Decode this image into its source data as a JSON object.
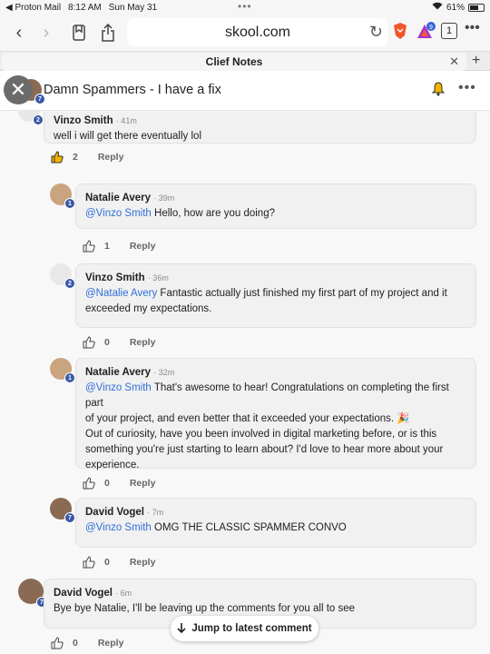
{
  "status": {
    "back_app": "Proton Mail",
    "time": "8:12 AM",
    "date": "Sun May 31",
    "battery": "61%",
    "battery_level": 0.61
  },
  "browser": {
    "url": "skool.com",
    "tab_count": "1",
    "tab_title": "Clief Notes"
  },
  "post": {
    "title": "Damn Spammers - I have a fix",
    "author_level": "7"
  },
  "colors": {
    "mention": "#2e6fd8",
    "level_badge": "#3a58a8",
    "brave_orange": "#f1562b"
  },
  "comments": [
    {
      "name": "Vinzo Smith",
      "time": "· 41m",
      "level": "2",
      "text": "well i will get there eventually lol",
      "likes": "2",
      "reply": "Reply"
    },
    {
      "name": "Natalie Avery",
      "time": "· 39m",
      "level": "1",
      "mention": "@Vinzo Smith",
      "text": " Hello, how are you doing?",
      "likes": "1",
      "reply": "Reply"
    },
    {
      "name": "Vinzo Smith",
      "time": "· 36m",
      "level": "2",
      "mention": "@Natalie Avery",
      "text_l1": " Fantastic actually just finished my first part of my project and it",
      "text_l2": "exceeded my expectations.",
      "likes": "0",
      "reply": "Reply"
    },
    {
      "name": "Natalie Avery",
      "time": "· 32m",
      "level": "1",
      "mention": "@Vinzo Smith",
      "text_l1": " That's awesome to hear! Congratulations on completing the first part",
      "text_l2": "of your project, and even better that it exceeded your expectations. 🎉",
      "text_l3": "Out of curiosity, have you been involved in digital marketing before, or is this",
      "text_l4": "something you're just starting to learn about? I'd love to hear more about your",
      "text_l5": "experience.",
      "likes": "0",
      "reply": "Reply"
    },
    {
      "name": "David Vogel",
      "time": "· 7m",
      "level": "7",
      "mention": "@Vinzo Smith",
      "text": " OMG THE CLASSIC SPAMMER CONVO",
      "likes": "0",
      "reply": "Reply"
    },
    {
      "name": "David Vogel",
      "time": "· 6m",
      "level": "7",
      "text": "Bye bye Natalie, I'll be leaving up the comments for you all to see",
      "likes": "0",
      "reply": "Reply"
    }
  ],
  "jump_label": "Jump to latest comment"
}
